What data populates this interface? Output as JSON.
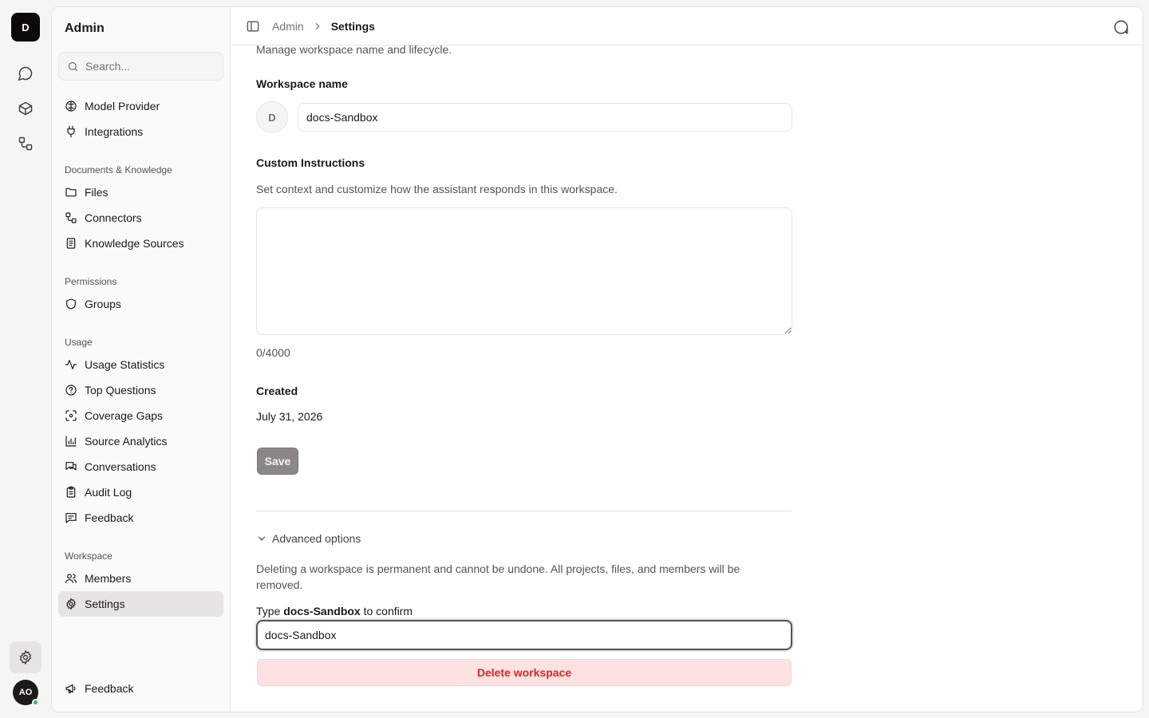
{
  "rail": {
    "workspace_initial": "D",
    "avatar_initials": "AO",
    "items": [
      "chat-icon",
      "cube-icon",
      "connectors-icon"
    ],
    "settings_icon": "gear-icon"
  },
  "sidebar": {
    "title": "Admin",
    "search_placeholder": "Search...",
    "top_items": [
      {
        "label": "Model Provider",
        "icon": "brain-icon"
      },
      {
        "label": "Integrations",
        "icon": "plug-icon"
      }
    ],
    "sections": [
      {
        "title": "Documents & Knowledge",
        "items": [
          {
            "label": "Files",
            "icon": "folder-icon"
          },
          {
            "label": "Connectors",
            "icon": "connectors-icon"
          },
          {
            "label": "Knowledge Sources",
            "icon": "book-icon"
          }
        ]
      },
      {
        "title": "Permissions",
        "items": [
          {
            "label": "Groups",
            "icon": "shield-icon"
          }
        ]
      },
      {
        "title": "Usage",
        "items": [
          {
            "label": "Usage Statistics",
            "icon": "activity-icon"
          },
          {
            "label": "Top Questions",
            "icon": "question-icon"
          },
          {
            "label": "Coverage Gaps",
            "icon": "scan-icon"
          },
          {
            "label": "Source Analytics",
            "icon": "bar-chart-icon"
          },
          {
            "label": "Conversations",
            "icon": "messages-icon"
          },
          {
            "label": "Audit Log",
            "icon": "clipboard-icon"
          },
          {
            "label": "Feedback",
            "icon": "feedback-icon"
          }
        ]
      },
      {
        "title": "Workspace",
        "items": [
          {
            "label": "Members",
            "icon": "users-icon"
          },
          {
            "label": "Settings",
            "icon": "gear-icon",
            "active": true
          }
        ]
      }
    ],
    "bottom_item": {
      "label": "Feedback",
      "icon": "megaphone-icon"
    }
  },
  "topbar": {
    "breadcrumb_parent": "Admin",
    "breadcrumb_current": "Settings"
  },
  "content": {
    "description": "Manage workspace name and lifecycle.",
    "workspace_name_label": "Workspace name",
    "workspace_initial": "D",
    "workspace_name_value": "docs-Sandbox",
    "custom_instructions_label": "Custom Instructions",
    "custom_instructions_desc": "Set context and customize how the assistant responds in this workspace.",
    "custom_instructions_value": "",
    "char_count": "0/4000",
    "created_label": "Created",
    "created_value": "July 31, 2026",
    "save_label": "Save",
    "advanced_label": "Advanced options",
    "delete_warning": "Deleting a workspace is permanent and cannot be undone. All projects, files, and members will be removed.",
    "confirm_prefix": "Type ",
    "confirm_name": "docs-Sandbox",
    "confirm_suffix": " to confirm",
    "confirm_value": "docs-Sandbox",
    "delete_label": "Delete workspace"
  },
  "colors": {
    "accent_dark": "#0c0a09",
    "delete_bg": "#fde2e2",
    "delete_text": "#dc2626",
    "status_online": "#22c55e"
  }
}
